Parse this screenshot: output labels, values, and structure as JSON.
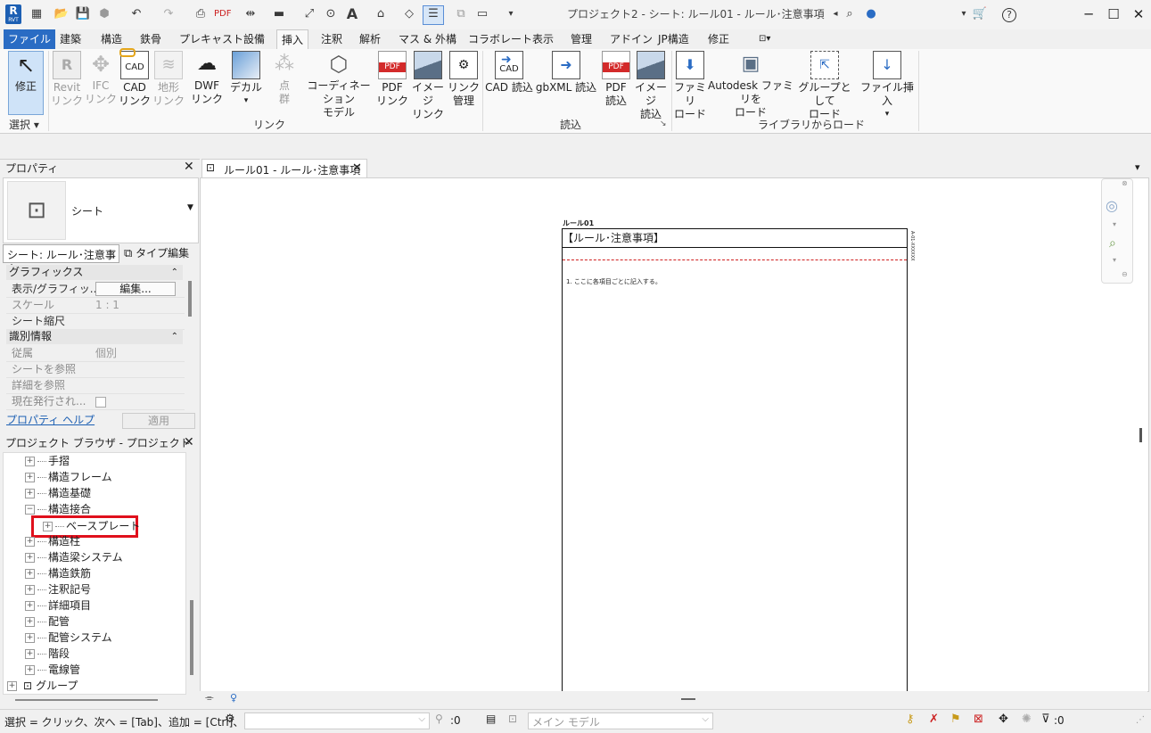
{
  "app": {
    "logo_letter": "R",
    "logo_sub": "RVT",
    "title": "プロジェクト2 - シート: ルール01 - ルール･注意事項",
    "quick_access_icons": [
      "open-icon",
      "save-icon",
      "sync-icon",
      "undo-icon",
      "redo-icon",
      "print-icon",
      "pdf-export-icon",
      "measure-icon",
      "dimension-icon",
      "tag-icon",
      "text-icon",
      "3d-view-icon",
      "section-icon",
      "thin-lines-icon",
      "close-hidden-icon",
      "switch-windows-icon",
      "customize-icon"
    ]
  },
  "ribbon_tabs": [
    "ファイル",
    "建築",
    "構造",
    "鉄骨",
    "プレキャスト",
    "設備",
    "挿入",
    "注釈",
    "解析",
    "マス & 外構",
    "コラボレート",
    "表示",
    "管理",
    "アドイン",
    "JP構造",
    "修正"
  ],
  "active_tab": "挿入",
  "ribbon": {
    "select": {
      "modify": "修正",
      "panel": "選択"
    },
    "link": {
      "buttons": [
        {
          "l1": "Revit",
          "l2": "リンク",
          "enabled": false
        },
        {
          "l1": "IFC",
          "l2": "リンク",
          "enabled": false
        },
        {
          "l1": "CAD",
          "l2": "リンク",
          "enabled": true
        },
        {
          "l1": "地形",
          "l2": "リンク",
          "enabled": false
        },
        {
          "l1": "DWF",
          "l2": "リンク",
          "enabled": true
        },
        {
          "l1": "デカル",
          "l2": "",
          "enabled": true
        },
        {
          "l1": "点",
          "l2": "群",
          "enabled": false
        },
        {
          "l1": "コーディネーション",
          "l2": "モデル",
          "enabled": true
        },
        {
          "l1": "PDF",
          "l2": "リンク",
          "enabled": true
        },
        {
          "l1": "イメージ",
          "l2": "リンク",
          "enabled": true
        },
        {
          "l1": "リンク",
          "l2": "管理",
          "enabled": true
        }
      ],
      "panel": "リンク"
    },
    "import": {
      "buttons": [
        {
          "l1": "CAD 読込",
          "l2": ""
        },
        {
          "l1": "gbXML 読込",
          "l2": ""
        },
        {
          "l1": "PDF",
          "l2": "読込"
        },
        {
          "l1": "イメージ",
          "l2": "読込"
        }
      ],
      "panel": "読込"
    },
    "library": {
      "buttons": [
        {
          "l1": "ファミリ",
          "l2": "ロード"
        },
        {
          "l1": "Autodesk ファミリを",
          "l2": "ロード"
        },
        {
          "l1": "グループとして",
          "l2": "ロード"
        },
        {
          "l1": "ファイル挿入",
          "l2": ""
        }
      ],
      "panel": "ライブラリからロード"
    }
  },
  "properties": {
    "title": "プロパティ",
    "type_name": "シート",
    "selector": "シート: ルール･注意事↑",
    "edit_type": "タイプ編集",
    "categories": [
      {
        "name": "グラフィックス",
        "rows": [
          {
            "k": "表示/グラフィッ...",
            "v": "編集..."
          },
          {
            "k": "スケール",
            "v": "1 : 1"
          },
          {
            "k": "シート縮尺",
            "v": ""
          }
        ]
      },
      {
        "name": "識別情報",
        "rows": [
          {
            "k": "従属",
            "v": "個別"
          },
          {
            "k": "シートを参照",
            "v": ""
          },
          {
            "k": "詳細を参照",
            "v": ""
          },
          {
            "k": "現在発行され...",
            "v": ""
          }
        ]
      }
    ],
    "help": "プロパティ ヘルプ",
    "apply": "適用"
  },
  "browser": {
    "title": "プロジェクト ブラウザ - プロジェクト2",
    "items": [
      {
        "label": "手摺",
        "level": 1,
        "expanded": false
      },
      {
        "label": "構造フレーム",
        "level": 1,
        "expanded": false
      },
      {
        "label": "構造基礎",
        "level": 1,
        "expanded": false
      },
      {
        "label": "構造接合",
        "level": 1,
        "expanded": true
      },
      {
        "label": "ベースプレート",
        "level": 2,
        "expanded": false,
        "highlighted": true
      },
      {
        "label": "構造柱",
        "level": 1,
        "expanded": false
      },
      {
        "label": "構造梁システム",
        "level": 1,
        "expanded": false
      },
      {
        "label": "構造鉄筋",
        "level": 1,
        "expanded": false
      },
      {
        "label": "注釈記号",
        "level": 1,
        "expanded": false
      },
      {
        "label": "詳細項目",
        "level": 1,
        "expanded": false
      },
      {
        "label": "配管",
        "level": 1,
        "expanded": false
      },
      {
        "label": "配管システム",
        "level": 1,
        "expanded": false
      },
      {
        "label": "階段",
        "level": 1,
        "expanded": false
      },
      {
        "label": "電線管",
        "level": 1,
        "expanded": false
      },
      {
        "label": "グループ",
        "level": 0,
        "expanded": false
      }
    ]
  },
  "view": {
    "tab_label": "ルール01 - ルール･注意事項",
    "sheet_number": "ルール01",
    "sheet_heading": "【ルール･注意事項】",
    "note": "1. ここに各項目ごとに記入する。",
    "side_text": "A-01-XXXXXX",
    "highlight_color": "#e0101c"
  },
  "status": {
    "hint": "選択 = クリック、次へ = [Tab]、追加 = [Ctrl]、選択",
    "count": ":0",
    "model": "メイン モデル",
    "filter_count": ":0"
  }
}
